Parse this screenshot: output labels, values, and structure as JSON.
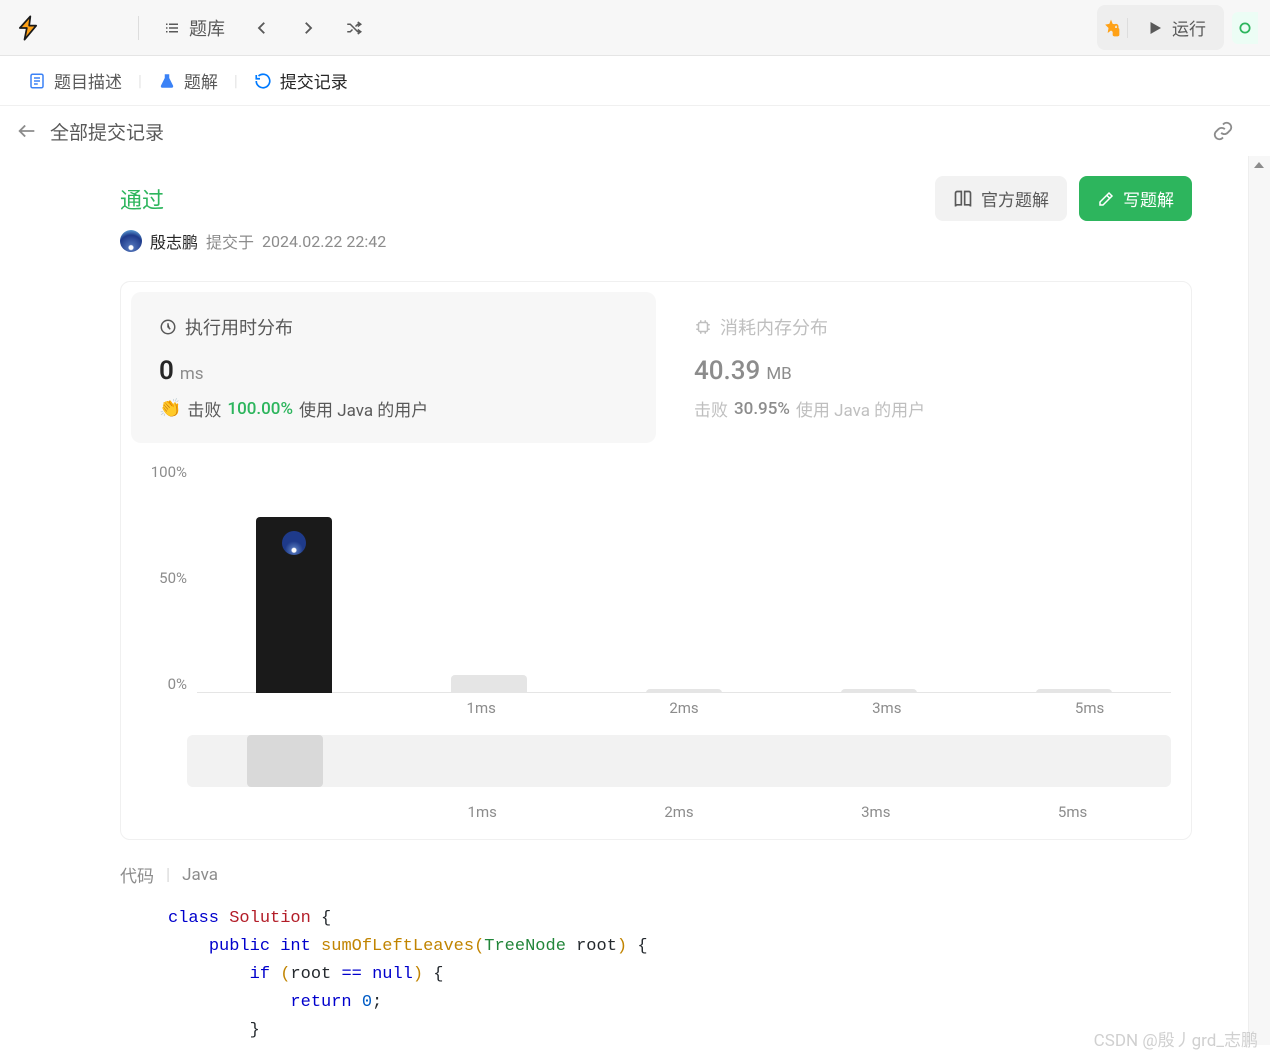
{
  "toolbar": {
    "problems_label": "题库",
    "run_label": "运行"
  },
  "tabs": {
    "description": "题目描述",
    "solution": "题解",
    "submissions": "提交记录"
  },
  "subheader": {
    "title": "全部提交记录"
  },
  "result": {
    "status": "通过",
    "author": "殷志鹏",
    "submitted_prefix": "提交于",
    "submitted_at": "2024.02.22 22:42",
    "official_btn": "官方题解",
    "write_btn": "写题解"
  },
  "stats": {
    "runtime": {
      "title": "执行用时分布",
      "value": "0",
      "unit": "ms",
      "beat_label": "击败",
      "beat_pct": "100.00%",
      "beat_suffix": "使用 Java 的用户"
    },
    "memory": {
      "title": "消耗内存分布",
      "value": "40.39",
      "unit": "MB",
      "beat_label": "击败",
      "beat_pct": "30.95%",
      "beat_suffix": "使用 Java 的用户"
    }
  },
  "chart_data": {
    "type": "bar",
    "categories": [
      "",
      "1ms",
      "2ms",
      "3ms",
      "5ms"
    ],
    "values": [
      88,
      9,
      2,
      1,
      1
    ],
    "ylabel": "",
    "yticks": [
      "100%",
      "50%",
      "0%"
    ],
    "ylim": [
      0,
      100
    ],
    "active_index": 0,
    "minimap_categories": [
      "",
      "1ms",
      "2ms",
      "3ms",
      "5ms"
    ]
  },
  "code": {
    "label": "代码",
    "language": "Java",
    "tokens": [
      [
        [
          "kw",
          "class "
        ],
        [
          "cls",
          "Solution"
        ],
        [
          "punct",
          " {"
        ]
      ],
      [
        [
          "punct",
          "    "
        ],
        [
          "kw",
          "public "
        ],
        [
          "kw",
          "int "
        ],
        [
          "fn",
          "sumOfLeftLeaves"
        ],
        [
          "paren",
          "("
        ],
        [
          "type",
          "TreeNode"
        ],
        [
          "var",
          " root"
        ],
        [
          "paren",
          ")"
        ],
        [
          "punct",
          " {"
        ]
      ],
      [
        [
          "punct",
          "        "
        ],
        [
          "kw",
          "if "
        ],
        [
          "paren",
          "("
        ],
        [
          "var",
          "root "
        ],
        [
          "kw",
          "== "
        ],
        [
          "kw",
          "null"
        ],
        [
          "paren",
          ")"
        ],
        [
          "punct",
          " {"
        ]
      ],
      [
        [
          "punct",
          "            "
        ],
        [
          "kw",
          "return "
        ],
        [
          "num",
          "0"
        ],
        [
          "punct",
          ";"
        ]
      ],
      [
        [
          "punct",
          "        }"
        ]
      ]
    ]
  },
  "watermark": "CSDN @殷丿grd_志鹏"
}
